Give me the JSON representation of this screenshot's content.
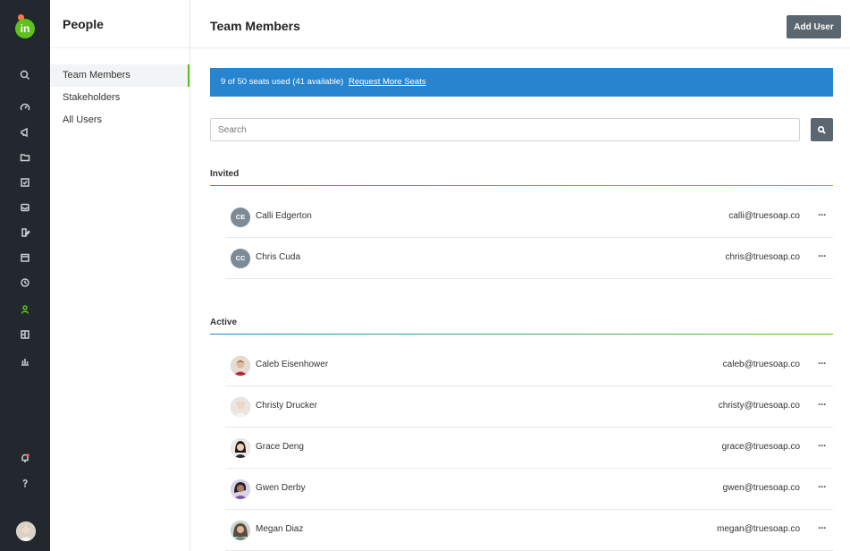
{
  "app": {
    "logo_text": "in"
  },
  "sidebar": {
    "title": "People",
    "items": [
      {
        "label": "Team Members"
      },
      {
        "label": "Stakeholders"
      },
      {
        "label": "All Users"
      }
    ]
  },
  "header": {
    "title": "Team Members",
    "add_user_label": "Add User"
  },
  "banner": {
    "text": "9 of 50 seats used (41 available)",
    "link": "Request More Seats"
  },
  "search": {
    "placeholder": "Search"
  },
  "invited": {
    "label": "Invited",
    "members": [
      {
        "initials": "CE",
        "name": "Calli Edgerton",
        "email": "calli@truesoap.co"
      },
      {
        "initials": "CC",
        "name": "Chris Cuda",
        "email": "chris@truesoap.co"
      }
    ]
  },
  "active": {
    "label": "Active",
    "members": [
      {
        "name": "Caleb Eisenhower",
        "email": "caleb@truesoap.co"
      },
      {
        "name": "Christy Drucker",
        "email": "christy@truesoap.co"
      },
      {
        "name": "Grace Deng",
        "email": "grace@truesoap.co"
      },
      {
        "name": "Gwen Derby",
        "email": "gwen@truesoap.co"
      },
      {
        "name": "Megan Diaz",
        "email": "megan@truesoap.co"
      }
    ]
  },
  "more_glyph": "···",
  "colors": {
    "accent": "#5fc11d",
    "banner": "#2785cf",
    "rail": "#22282d",
    "button": "#5b6770"
  }
}
